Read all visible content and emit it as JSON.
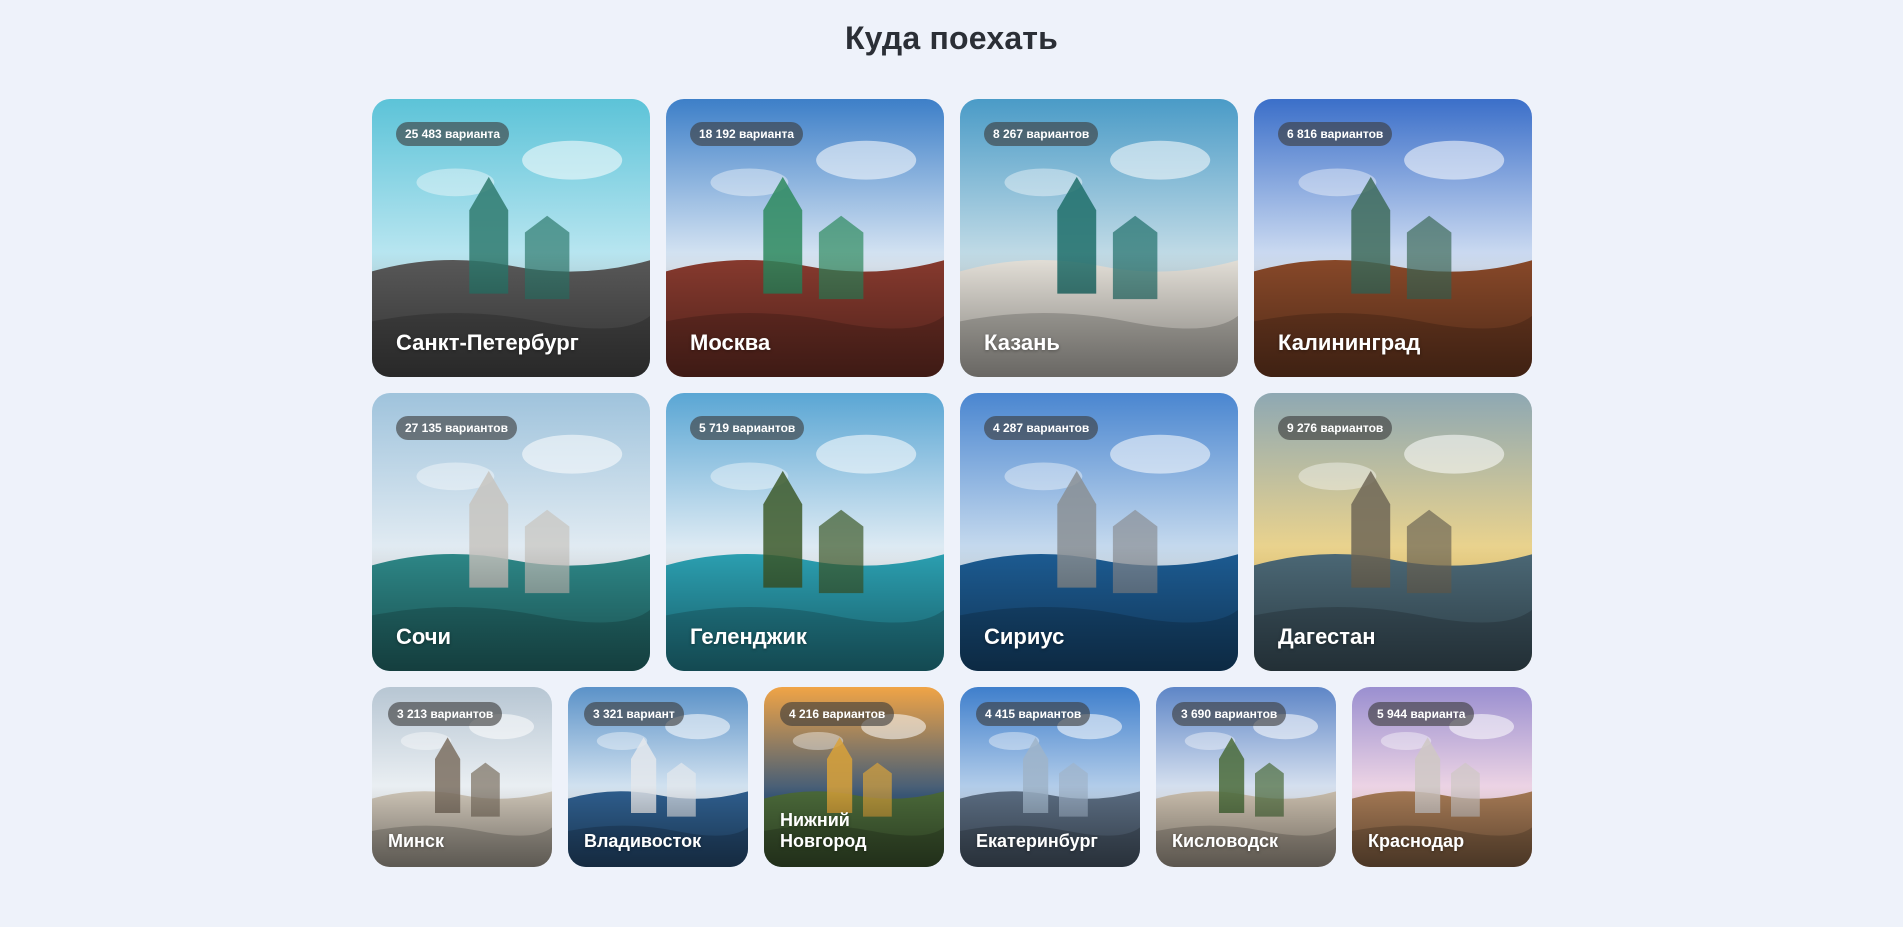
{
  "header": {
    "title": "Куда поехать"
  },
  "row1": [
    {
      "name": "Санкт-Петербург",
      "count": "25 483 варианта",
      "palette": {
        "sky": "#5cc3d8",
        "sky2": "#bfe8f2",
        "ground": "#5a5a5a",
        "accent": "#2f7a6e"
      }
    },
    {
      "name": "Москва",
      "count": "18 192 варианта",
      "palette": {
        "sky": "#3d7fc8",
        "sky2": "#dfeaf5",
        "ground": "#8a3b2f",
        "accent": "#2e8a5e"
      }
    },
    {
      "name": "Казань",
      "count": "8 267 вариантов",
      "palette": {
        "sky": "#4a9bc7",
        "sky2": "#c9dfe8",
        "ground": "#e8e4dc",
        "accent": "#1f6f6a"
      }
    },
    {
      "name": "Калининград",
      "count": "6 816 вариантов",
      "palette": {
        "sky": "#3b6fc9",
        "sky2": "#d6e2f4",
        "ground": "#8b4a2a",
        "accent": "#3e6b5a"
      }
    }
  ],
  "row2": [
    {
      "name": "Сочи",
      "count": "27 135 вариантов",
      "palette": {
        "sky": "#9fc3dc",
        "sky2": "#e6eef4",
        "ground": "#2e8a8a",
        "accent": "#c7c4bf"
      }
    },
    {
      "name": "Геленджик",
      "count": "5 719 вариантов",
      "palette": {
        "sky": "#5aa6d4",
        "sky2": "#e8f0f6",
        "ground": "#2ca3b5",
        "accent": "#3d5a2a"
      }
    },
    {
      "name": "Сириус",
      "count": "4 287 вариантов",
      "palette": {
        "sky": "#4a86d0",
        "sky2": "#cfe0f0",
        "ground": "#1d5d95",
        "accent": "#8a8f94"
      }
    },
    {
      "name": "Дагестан",
      "count": "9 276 вариантов",
      "palette": {
        "sky": "#8ea8b3",
        "sky2": "#f1d68a",
        "ground": "#4d6a78",
        "accent": "#6e6656"
      }
    }
  ],
  "row3": [
    {
      "name": "Минск",
      "count": "3 213 вариантов",
      "palette": {
        "sky": "#b7c6d3",
        "sky2": "#eef2f5",
        "ground": "#cfc6b8",
        "accent": "#7b6f60"
      }
    },
    {
      "name": "Владивосток",
      "count": "3 321 вариант",
      "palette": {
        "sky": "#5b92c8",
        "sky2": "#dbe8f3",
        "ground": "#2f5f8f",
        "accent": "#e4e8ec"
      }
    },
    {
      "name": "Нижний Новгород",
      "count": "4 216 вариантов",
      "palette": {
        "sky": "#f0a446",
        "sky2": "#3c5a7a",
        "ground": "#4b6a3a",
        "accent": "#d9a23a"
      }
    },
    {
      "name": "Екатеринбург",
      "count": "4 415 вариантов",
      "palette": {
        "sky": "#3f7fcc",
        "sky2": "#bcd3ec",
        "ground": "#5b6d82",
        "accent": "#9fb4c9"
      }
    },
    {
      "name": "Кисловодск",
      "count": "3 690 вариантов",
      "palette": {
        "sky": "#5e86c7",
        "sky2": "#dfe7f2",
        "ground": "#cbbfae",
        "accent": "#4a6b3a"
      }
    },
    {
      "name": "Краснодар",
      "count": "5 944 варианта",
      "palette": {
        "sky": "#9a8fd0",
        "sky2": "#f3d9e6",
        "ground": "#a67a55",
        "accent": "#cfc8c4"
      }
    }
  ]
}
